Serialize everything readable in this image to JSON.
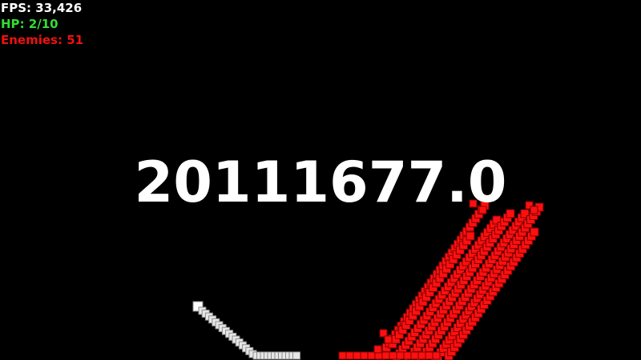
{
  "hud": {
    "fps": {
      "label": "FPS",
      "value": "33,426",
      "color": "#ffffff"
    },
    "hp": {
      "label": "HP",
      "value": "2/10",
      "color": "#33dd33"
    },
    "enemies": {
      "label": "Enemies",
      "value": "51",
      "color": "#ee1111"
    }
  },
  "score": {
    "value": "20111677.0",
    "color": "#ffffff"
  },
  "colors": {
    "background": "#000000",
    "player_trail_fill": "#e6e6e6",
    "player_trail_edge": "#8c8c8c",
    "enemy_fill": "#ff1010",
    "enemy_edge": "#7a0000"
  },
  "icons": {
    "player_block": "player-trail-block",
    "enemy_block": "enemy-block"
  }
}
